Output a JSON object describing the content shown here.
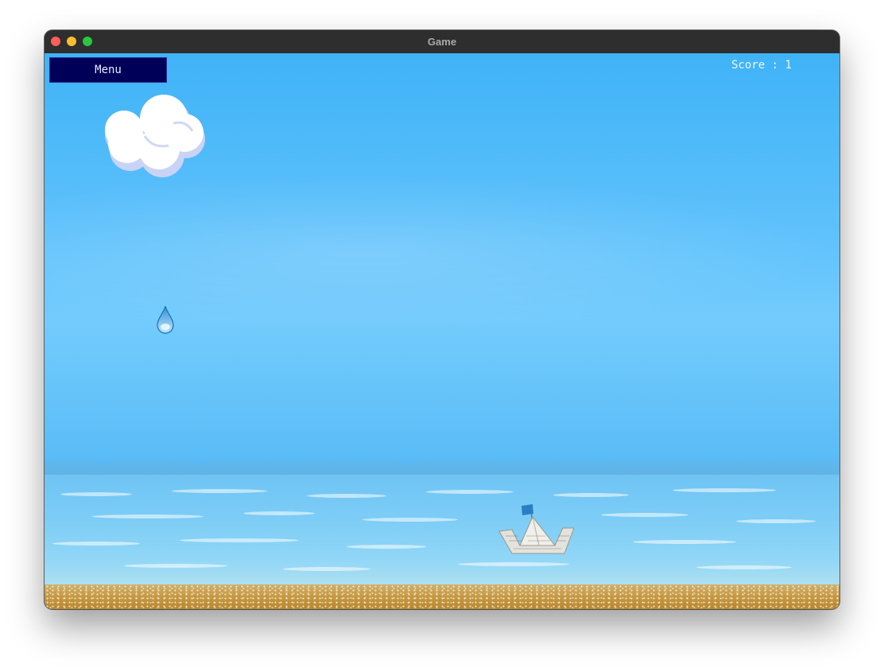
{
  "window": {
    "title": "Game"
  },
  "hud": {
    "menu_label": "Menu",
    "score_label": "Score",
    "score_separator": " : ",
    "score_value": "1"
  },
  "scene": {
    "objects": [
      {
        "kind": "cloud",
        "icon": "cloud-icon"
      },
      {
        "kind": "raindrop",
        "icon": "raindrop-icon"
      },
      {
        "kind": "paper-boat",
        "icon": "paper-boat-icon"
      }
    ],
    "colors": {
      "sky": "#4fb8f8",
      "sea": "#7dcdf6",
      "sand": "#c79a45",
      "menu_button": "#000058"
    }
  }
}
